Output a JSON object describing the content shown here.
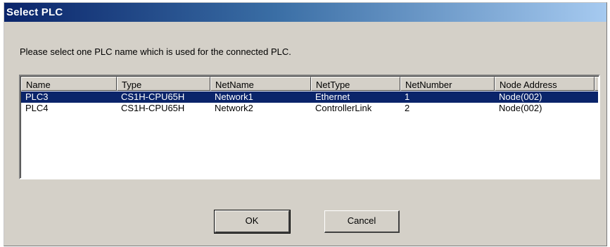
{
  "window": {
    "title": "Select PLC"
  },
  "prompt": "Please select one PLC name which is used for the connected PLC.",
  "list": {
    "columns": [
      "Name",
      "Type",
      "NetName",
      "NetType",
      "NetNumber",
      "Node Address"
    ],
    "rows": [
      {
        "selected": true,
        "cells": [
          "PLC3",
          "CS1H-CPU65H",
          "Network1",
          "Ethernet",
          "1",
          "Node(002)"
        ]
      },
      {
        "selected": false,
        "cells": [
          "PLC4",
          "CS1H-CPU65H",
          "Network2",
          "ControllerLink",
          "2",
          "Node(002)"
        ]
      }
    ]
  },
  "buttons": {
    "ok": "OK",
    "cancel": "Cancel"
  },
  "colors": {
    "titlebar_start": "#0a246a",
    "titlebar_end": "#a6caf0",
    "selection": "#0a246a",
    "face": "#d4d0c8"
  }
}
